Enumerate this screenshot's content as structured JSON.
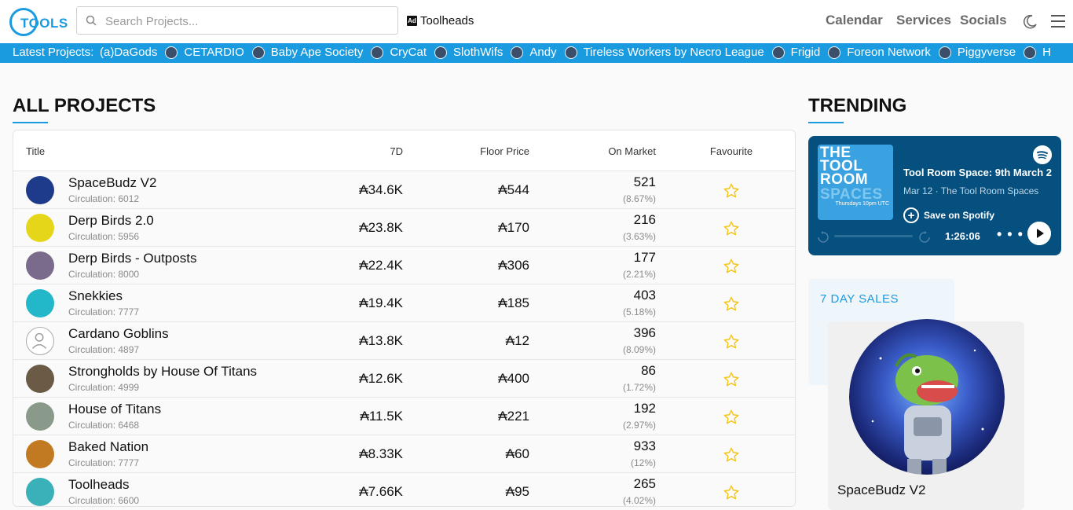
{
  "header": {
    "logo_text": "TOOLS",
    "search_placeholder": "Search Projects...",
    "ad_badge": "Ad",
    "ad_label": "Toolheads",
    "nav": [
      "Calendar",
      "Services",
      "Socials"
    ]
  },
  "ticker": {
    "label": "Latest Projects:",
    "first": "(a)DaGods",
    "items": [
      "CETARDIO",
      "Baby Ape Society",
      "CryCat",
      "SlothWifs",
      "Andy",
      "Tireless Workers by Necro League",
      "Frigid",
      "Foreon Network",
      "Piggyverse",
      "H"
    ]
  },
  "all_projects": {
    "title": "ALL PROJECTS",
    "columns": {
      "title": "Title",
      "d7": "7D",
      "floor": "Floor Price",
      "market": "On Market",
      "fav": "Favourite"
    },
    "rows": [
      {
        "name": "SpaceBudz V2",
        "circulation": "Circulation: 6012",
        "d7": "₳34.6K",
        "floor": "₳544",
        "market": "521",
        "pct": "(8.67%)",
        "color": "#1e3a8a"
      },
      {
        "name": "Derp Birds 2.0",
        "circulation": "Circulation: 5956",
        "d7": "₳23.8K",
        "floor": "₳170",
        "market": "216",
        "pct": "(3.63%)",
        "color": "#e6d619"
      },
      {
        "name": "Derp Birds - Outposts",
        "circulation": "Circulation: 8000",
        "d7": "₳22.4K",
        "floor": "₳306",
        "market": "177",
        "pct": "(2.21%)",
        "color": "#7a6a8c"
      },
      {
        "name": "Snekkies",
        "circulation": "Circulation: 7777",
        "d7": "₳19.4K",
        "floor": "₳185",
        "market": "403",
        "pct": "(5.18%)",
        "color": "#22b8c9"
      },
      {
        "name": "Cardano Goblins",
        "circulation": "Circulation: 4897",
        "d7": "₳13.8K",
        "floor": "₳12",
        "market": "396",
        "pct": "(8.09%)",
        "color": "#ffffff"
      },
      {
        "name": "Strongholds by House Of Titans",
        "circulation": "Circulation: 4999",
        "d7": "₳12.6K",
        "floor": "₳400",
        "market": "86",
        "pct": "(1.72%)",
        "color": "#6b5a45"
      },
      {
        "name": "House of Titans",
        "circulation": "Circulation: 6468",
        "d7": "₳11.5K",
        "floor": "₳221",
        "market": "192",
        "pct": "(2.97%)",
        "color": "#8a9a8a"
      },
      {
        "name": "Baked Nation",
        "circulation": "Circulation: 7777",
        "d7": "₳8.33K",
        "floor": "₳60",
        "market": "933",
        "pct": "(12%)",
        "color": "#c27a22"
      },
      {
        "name": "Toolheads",
        "circulation": "Circulation: 6600",
        "d7": "₳7.66K",
        "floor": "₳95",
        "market": "265",
        "pct": "(4.02%)",
        "color": "#3ab0b8"
      }
    ]
  },
  "trending": {
    "title": "TRENDING",
    "spotify": {
      "cover_line1": "THE",
      "cover_line2": "TOOL",
      "cover_line3": "ROOM",
      "cover_line4": "SPACES",
      "cover_note": "Thursdays 10pm UTC",
      "title": "Tool Room Space: 9th March 2",
      "subtitle": "Mar 12 · The Tool Room Spaces",
      "save": "Save on Spotify",
      "time": "1:26:06",
      "more": "• • •"
    }
  },
  "sales": {
    "label": "7 DAY SALES",
    "name": "SpaceBudz V2"
  },
  "colors": {
    "accent": "#1a9be0",
    "spotify_bg": "#05507f",
    "star": "#f5c518"
  }
}
